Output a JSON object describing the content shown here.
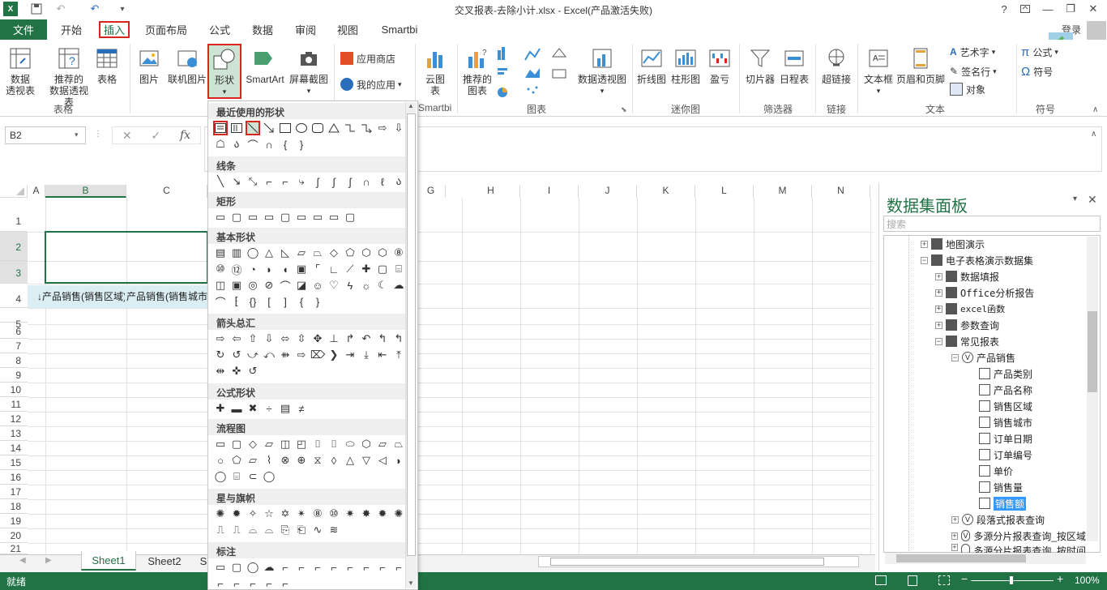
{
  "window": {
    "title": "交叉报表-去除小计.xlsx - Excel(产品激活失败)",
    "help": "?",
    "login": "登录"
  },
  "tabs": [
    "文件",
    "开始",
    "插入",
    "页面布局",
    "公式",
    "数据",
    "审阅",
    "视图",
    "Smartbi"
  ],
  "ribbon": {
    "table_group": {
      "label": "表格",
      "pivot": "数据\n透视表",
      "pivot_l1": "数据",
      "pivot_l2": "透视表",
      "rec_pivot_l1": "推荐的",
      "rec_pivot_l2": "数据透视表",
      "table": "表格"
    },
    "illus_group": {
      "picture": "图片",
      "online_picture": "联机图片",
      "shapes": "形状",
      "smartart": "SmartArt",
      "screenshot": "屏幕截图"
    },
    "apps": {
      "store": "应用商店",
      "my_apps": "我的应用"
    },
    "smartbi_group": {
      "cloud_l1": "云图",
      "cloud_l2": "表",
      "label": "Smartbi"
    },
    "charts_group": {
      "rec_l1": "推荐的",
      "rec_l2": "图表",
      "pivot_chart": "数据透视图",
      "label": "图表"
    },
    "spark_group": {
      "line": "折线图",
      "column": "柱形图",
      "winloss": "盈亏",
      "label": "迷你图"
    },
    "filter_group": {
      "slicer": "切片器",
      "timeline": "日程表",
      "label": "筛选器"
    },
    "link_group": {
      "hyperlink": "超链接",
      "label": "链接"
    },
    "text_group": {
      "textbox": "文本框",
      "header": "页眉和页脚",
      "wordart": "艺术字",
      "signature": "签名行",
      "object": "对象",
      "label": "文本"
    },
    "symbol_group": {
      "equation": "公式",
      "symbol": "符号",
      "label": "符号"
    }
  },
  "formula_bar": {
    "namebox": "B2",
    "fx": "fx",
    "cancel": "✕",
    "enter": "✓"
  },
  "grid": {
    "columns": [
      "A",
      "B",
      "C",
      "G",
      "H",
      "I",
      "J",
      "K",
      "L",
      "M",
      "N"
    ],
    "rows": [
      "1",
      "2",
      "3",
      "4",
      "5",
      "6",
      "7",
      "8",
      "9",
      "10",
      "11",
      "12",
      "13",
      "14",
      "15",
      "16",
      "17",
      "18",
      "19",
      "20",
      "21"
    ],
    "b4": "↓产品销售(销售区域)",
    "c4": "产品销售(销售城市"
  },
  "sheets": [
    "Sheet1",
    "Sheet2",
    "S"
  ],
  "status": {
    "ready": "就绪",
    "zoom": "100%",
    "minus": "−",
    "plus": "+"
  },
  "shapes_menu": {
    "sections": [
      "最近使用的形状",
      "线条",
      "矩形",
      "基本形状",
      "箭头总汇",
      "公式形状",
      "流程图",
      "星与旗帜",
      "标注"
    ]
  },
  "panel": {
    "title": "数据集面板",
    "search_placeholder": "搜索",
    "tree": [
      {
        "label": "地图演示"
      },
      {
        "label": "电子表格演示数据集"
      },
      {
        "label": "数据填报"
      },
      {
        "label": "Office分析报告"
      },
      {
        "label": "excel函数"
      },
      {
        "label": "参数查询"
      },
      {
        "label": "常见报表"
      },
      {
        "label": "产品销售"
      },
      {
        "label": "产品类别"
      },
      {
        "label": "产品名称"
      },
      {
        "label": "销售区域"
      },
      {
        "label": "销售城市"
      },
      {
        "label": "订单日期"
      },
      {
        "label": "订单编号"
      },
      {
        "label": "单价"
      },
      {
        "label": "销售量"
      },
      {
        "label": "销售额"
      },
      {
        "label": "段落式报表查询"
      },
      {
        "label": "多源分片报表查询_按区域"
      },
      {
        "label": "多源分片报表查询_按时间"
      }
    ]
  },
  "colors": {
    "excel_green": "#217346",
    "highlight_red": "#d9251c",
    "select_blue": "#3399ff"
  }
}
